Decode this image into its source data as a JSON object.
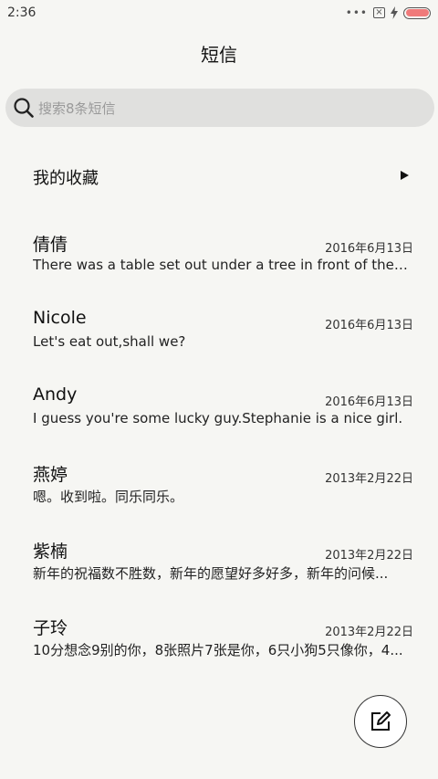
{
  "status_bar": {
    "time": "2:36",
    "icons": [
      "more-dots-icon",
      "sim-card-icon",
      "charging-bolt-icon",
      "battery-icon"
    ],
    "battery_color": "#f07a7a"
  },
  "header": {
    "title": "短信"
  },
  "search": {
    "placeholder": "搜索8条短信"
  },
  "favorites": {
    "label": "我的收藏",
    "icon": "triangle-right-icon"
  },
  "conversations": [
    {
      "name": "倩倩",
      "date": "2016年6月13日",
      "preview": "There was a table set out under a tree in front of the ho..."
    },
    {
      "name": "Nicole",
      "date": "2016年6月13日",
      "preview": "Let's eat out,shall we?"
    },
    {
      "name": "Andy",
      "date": "2016年6月13日",
      "preview": "I guess you're some lucky guy.Stephanie is a nice girl."
    },
    {
      "name": "燕婷",
      "date": "2013年2月22日",
      "preview": "嗯。收到啦。同乐同乐。"
    },
    {
      "name": "紫楠",
      "date": "2013年2月22日",
      "preview": "新年的祝福数不胜数，新年的愿望好多好多，新年的问候..."
    },
    {
      "name": "子玲",
      "date": "2013年2月22日",
      "preview": "10分想念9别的你，8张照片7张是你，6只小狗5只像你，4..."
    }
  ],
  "compose": {
    "icon": "compose-edit-icon"
  }
}
